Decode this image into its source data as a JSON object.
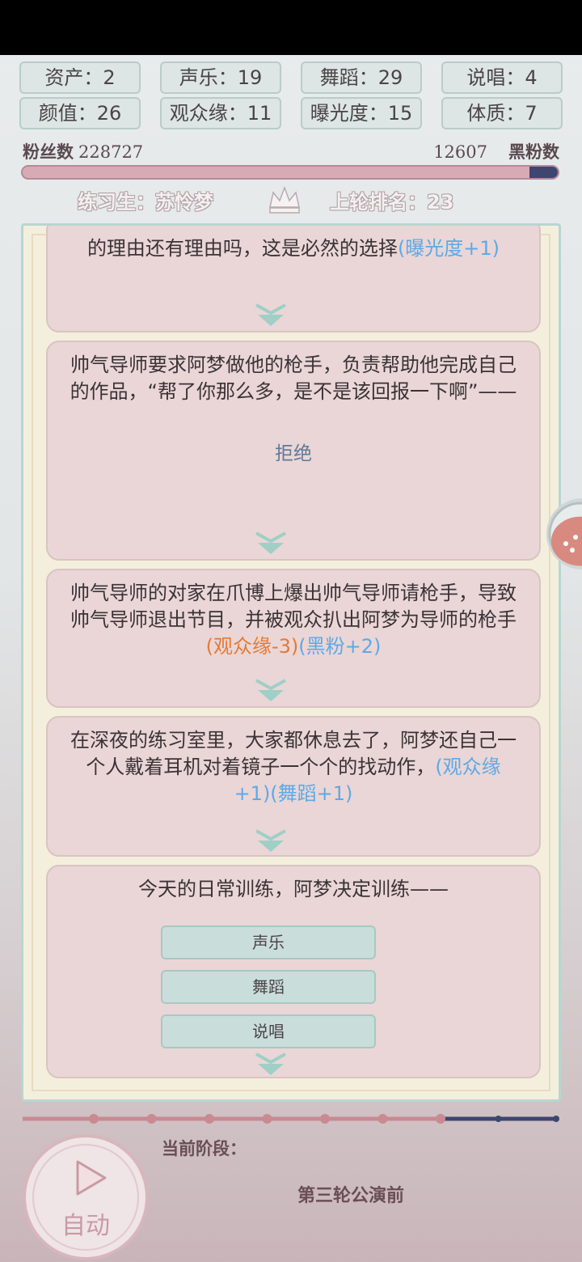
{
  "stats": [
    {
      "label": "资产",
      "value": "2"
    },
    {
      "label": "声乐",
      "value": "19"
    },
    {
      "label": "舞蹈",
      "value": "29"
    },
    {
      "label": "说唱",
      "value": "4"
    },
    {
      "label": "颜值",
      "value": "26"
    },
    {
      "label": "观众缘",
      "value": "11"
    },
    {
      "label": "曝光度",
      "value": "15"
    },
    {
      "label": "体质",
      "value": "7"
    }
  ],
  "fans": {
    "fans_label": "粉丝数",
    "fans_value": "228727",
    "black_value": "12607",
    "black_label": "黑粉数",
    "black_fraction": 0.0522
  },
  "trainee": "练习生：苏怜梦",
  "rank": "上轮排名：23",
  "story": {
    "card1": {
      "text": "的理由还有理由吗，这是必然的选择",
      "effect": "(曝光度+1)"
    },
    "card2": {
      "text": "帅气导师要求阿梦做他的枪手，负责帮助他完成自己的作品，“帮了你那么多，是不是该回报一下啊”——",
      "choice": "拒绝"
    },
    "card3": {
      "text": "帅气导师的对家在爪博上爆出帅气导师请枪手，导致帅气导师退出节目，并被观众扒出阿梦为导师的枪手",
      "effect_neg": "(观众缘-3)",
      "effect_pos": "(黑粉+2)"
    },
    "card4": {
      "text": "在深夜的练习室里，大家都休息去了，阿梦还自己一个人戴着耳机对着镜子一个个的找动作，",
      "effect": "(观众缘+1)(舞蹈+1)"
    },
    "card5": {
      "text": "今天的日常训练，阿梦决定训练——",
      "options": [
        "声乐",
        "舞蹈",
        "说唱"
      ]
    }
  },
  "progress": {
    "stages_total": 10,
    "stages_done": 8
  },
  "stage_label": "当前阶段：",
  "stage_value": "第三轮公演前",
  "auto_label": "自动",
  "colors": {
    "fan_bar": "#d8aab6",
    "black_bar": "#3e4670",
    "positive_effect": "#5ea9e6",
    "negative_effect": "#e47a35",
    "card_bg": "#ead6d6"
  }
}
